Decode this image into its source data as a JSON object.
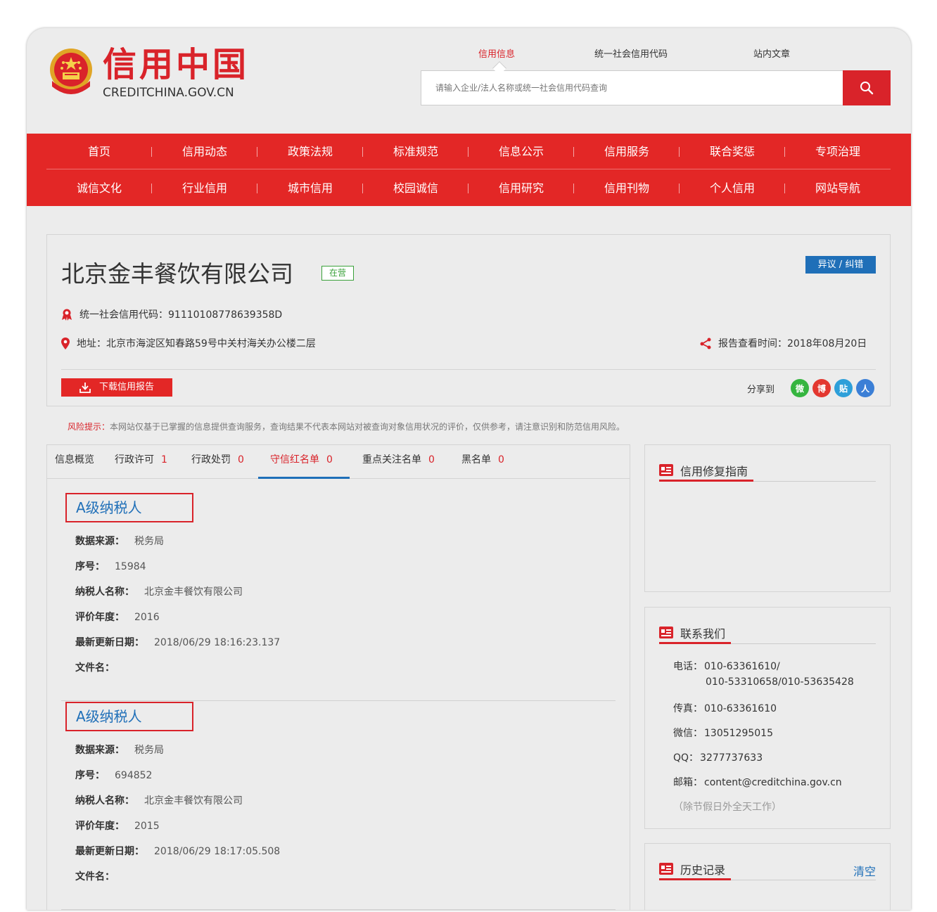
{
  "header": {
    "logo_cn": "信用中国",
    "logo_en": "CREDITCHINA.GOV.CN",
    "search_tabs": [
      "信用信息",
      "统一社会信用代码",
      "站内文章"
    ],
    "search_placeholder": "请输入企业/法人名称或统一社会信用代码查询"
  },
  "nav": {
    "row1": [
      "首页",
      "信用动态",
      "政策法规",
      "标准规范",
      "信息公示",
      "信用服务",
      "联合奖惩",
      "专项治理"
    ],
    "row2": [
      "诚信文化",
      "行业信用",
      "城市信用",
      "校园诚信",
      "信用研究",
      "信用刊物",
      "个人信用",
      "网站导航"
    ]
  },
  "company": {
    "name": "北京金丰餐饮有限公司",
    "status": "在营",
    "dispute_label": "异议 / 纠错",
    "credit_code": "统一社会信用代码：91110108778639358D",
    "address": "地址：北京市海淀区知春路59号中关村海关办公楼二层",
    "report_time": "报告查看时间：2018年08月20日",
    "download_label": "下载信用报告",
    "share_label": "分享到",
    "share_icons": [
      "wechat-icon",
      "weibo-icon",
      "tieba-icon",
      "renren-icon"
    ],
    "share_glyphs": [
      "微",
      "博",
      "贴",
      "人"
    ]
  },
  "risk": {
    "label": "风险提示：",
    "text": "本网站仅基于已掌握的信息提供查询服务，查询结果不代表本网站对被查询对象信用状况的评价，仅供参考，请注意识别和防范信用风险。"
  },
  "tabs": [
    {
      "label": "信息概览",
      "count": ""
    },
    {
      "label": "行政许可",
      "count": "1"
    },
    {
      "label": "行政处罚",
      "count": "0"
    },
    {
      "label": "守信红名单",
      "count": "0"
    },
    {
      "label": "重点关注名单",
      "count": "0"
    },
    {
      "label": "黑名单",
      "count": "0"
    }
  ],
  "field_labels": {
    "source": "数据来源：",
    "serial": "序号：",
    "taxpayer": "纳税人名称：",
    "year": "评价年度：",
    "updated": "最新更新日期：",
    "file": "文件名："
  },
  "records": [
    {
      "title": "A级纳税人",
      "source": "税务局",
      "serial": "15984",
      "taxpayer": "北京金丰餐饮有限公司",
      "year": "2016",
      "updated": "2018/06/29 18:16:23.137",
      "file": ""
    },
    {
      "title": "A级纳税人",
      "source": "税务局",
      "serial": "694852",
      "taxpayer": "北京金丰餐饮有限公司",
      "year": "2015",
      "updated": "2018/06/29 18:17:05.508",
      "file": ""
    }
  ],
  "sidebar": {
    "repair_title": "信用修复指南",
    "contact_title": "联系我们",
    "contact": {
      "phone_label": "电话：",
      "phone_1": "010-63361610/",
      "phone_2": "010-53310658/010-53635428",
      "fax_label": "传真：",
      "fax": "010-63361610",
      "wechat_label": "微信：",
      "wechat": "13051295015",
      "qq_label": "QQ：",
      "qq": "3277737633",
      "email_label": "邮箱：",
      "email": "content@creditchina.gov.cn",
      "note": "（除节假日外全天工作）"
    },
    "history_title": "历史记录",
    "clear_label": "清空"
  },
  "colors": {
    "brand_red": "#e32726",
    "link_blue": "#1f6fb8",
    "status_green": "#3aa13a"
  }
}
